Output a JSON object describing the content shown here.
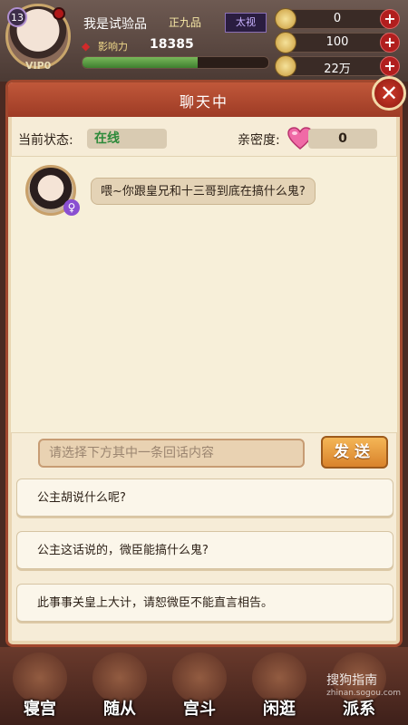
{
  "hud": {
    "level": "13",
    "vip": "VIP0",
    "player_name": "我是试验品",
    "rank_tag": "正九品",
    "rank_badge": "太视",
    "power_label": "影响力",
    "power_value": "18385",
    "power_progress": 0.62,
    "resources": [
      {
        "icon": "coin-icon",
        "value": "0"
      },
      {
        "icon": "ingot-icon",
        "value": "100"
      },
      {
        "icon": "silver-icon",
        "value": "22万"
      }
    ],
    "plus_label": "+"
  },
  "dialog": {
    "title": "聊天中",
    "close_label": "✕",
    "status_label": "当前状态:",
    "status_value": "在线",
    "intimacy_label": "亲密度:",
    "intimacy_value": "0",
    "npc_gender": "♀",
    "npc_message": "喂~你跟皇兄和十三哥到底在搞什么鬼?",
    "input_placeholder": "请选择下方其中一条回话内容",
    "send_label": "发送",
    "reply_options": [
      "公主胡说什么呢?",
      "公主这话说的，微臣能搞什么鬼?",
      "此事事关皇上大计，请恕微臣不能直言相告。"
    ]
  },
  "nav": {
    "items": [
      {
        "label": "寝宫",
        "icon": "palace-icon"
      },
      {
        "label": "随从",
        "icon": "attendant-icon"
      },
      {
        "label": "宫斗",
        "icon": "battle-icon"
      },
      {
        "label": "闲逛",
        "icon": "stroll-icon"
      },
      {
        "label": "派系",
        "icon": "faction-icon"
      }
    ]
  },
  "watermark": {
    "text": "搜狗指南",
    "sub": "zhinan.sogou.com"
  },
  "colors": {
    "accent_red": "#a1472d",
    "online_green": "#2d8a3a",
    "send_orange": "#e5952f"
  }
}
